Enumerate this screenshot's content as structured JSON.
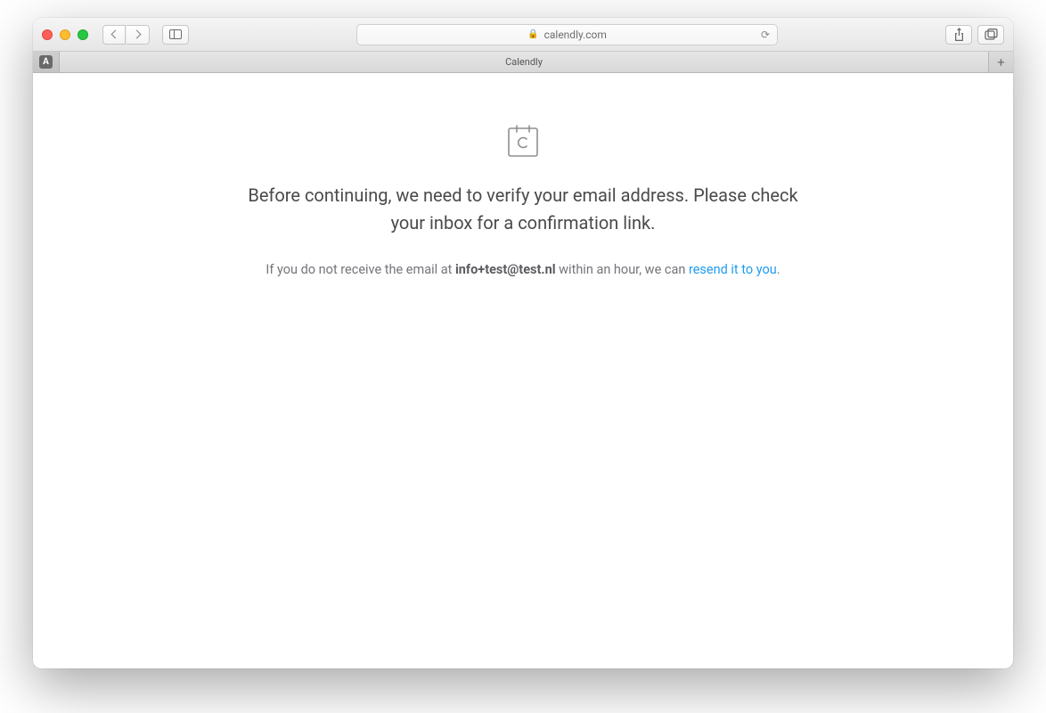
{
  "browser": {
    "url_host": "calendly.com",
    "tab_title": "Calendly",
    "pinned_favicon_letter": "A"
  },
  "page": {
    "headline": "Before continuing, we need to verify your email address. Please check your inbox for a confirmation link.",
    "sub_prefix": "If you do not receive the email at ",
    "email": "info+test@test.nl",
    "sub_mid": " within an hour, we can ",
    "resend_link": "resend it to you",
    "sub_suffix": "."
  }
}
